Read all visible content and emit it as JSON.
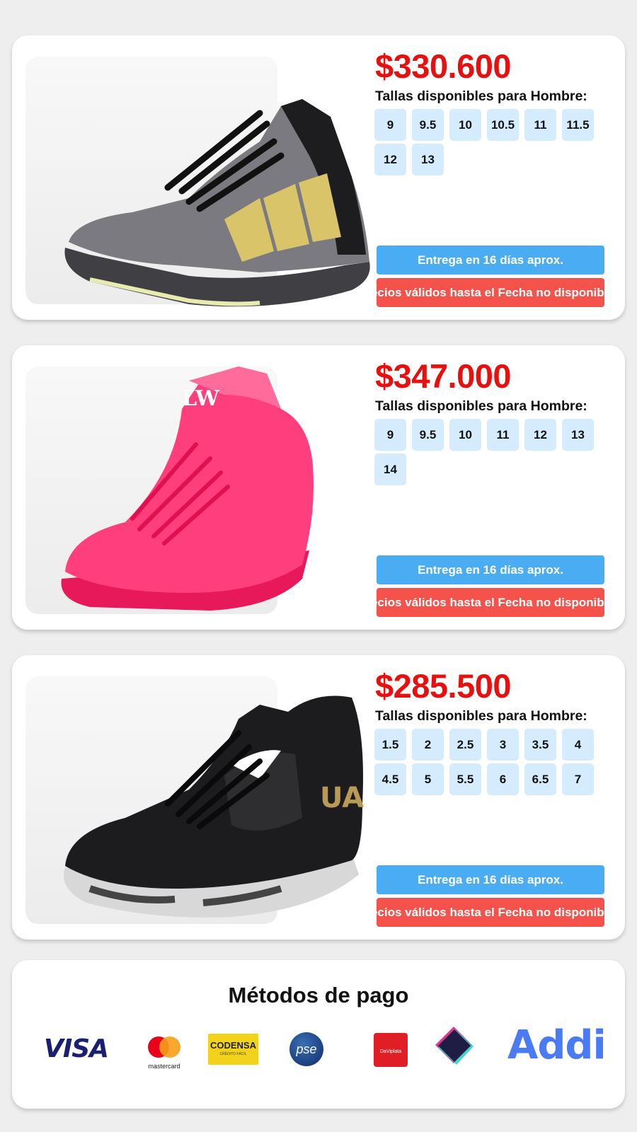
{
  "products": [
    {
      "price": "$330.600",
      "sizes_title": "Tallas disponibles para Hombre:",
      "sizes": [
        "9",
        "9.5",
        "10",
        "10.5",
        "11",
        "11.5",
        "12",
        "13"
      ],
      "delivery": "Entrega en 16 días aprox.",
      "validity": "Precios válidos hasta el Fecha no disponible",
      "image": "gray-black-gold-stripe-basketball-shoe"
    },
    {
      "price": "$347.000",
      "sizes_title": "Tallas disponibles para Hombre:",
      "sizes": [
        "9",
        "9.5",
        "10",
        "11",
        "12",
        "13",
        "14"
      ],
      "delivery": "Entrega en 16 días aprox.",
      "validity": "Precios válidos hasta el Fecha no disponible",
      "image": "pink-high-top-basketball-shoe"
    },
    {
      "price": "$285.500",
      "sizes_title": "Tallas disponibles para Hombre:",
      "sizes": [
        "1.5",
        "2",
        "2.5",
        "3",
        "3.5",
        "4",
        "4.5",
        "5",
        "5.5",
        "6",
        "6.5",
        "7"
      ],
      "delivery": "Entrega en 16 días aprox.",
      "validity": "Precios válidos hasta el Fecha no disponible",
      "image": "black-under-armour-basketball-shoe"
    }
  ],
  "payments": {
    "title": "Métodos de pago",
    "logos": {
      "visa": "VISA",
      "mastercard": "mastercard",
      "codensa": "CODENSA",
      "codensa_sub": "CRÉDITO FÁCIL",
      "pse": "pse",
      "daviplata": "DaViplata",
      "addi": "Addi"
    }
  },
  "colors": {
    "price": "#e8100f",
    "size_chip": "#d5ecff",
    "delivery": "#4aacf3",
    "validity": "#f4524a"
  }
}
